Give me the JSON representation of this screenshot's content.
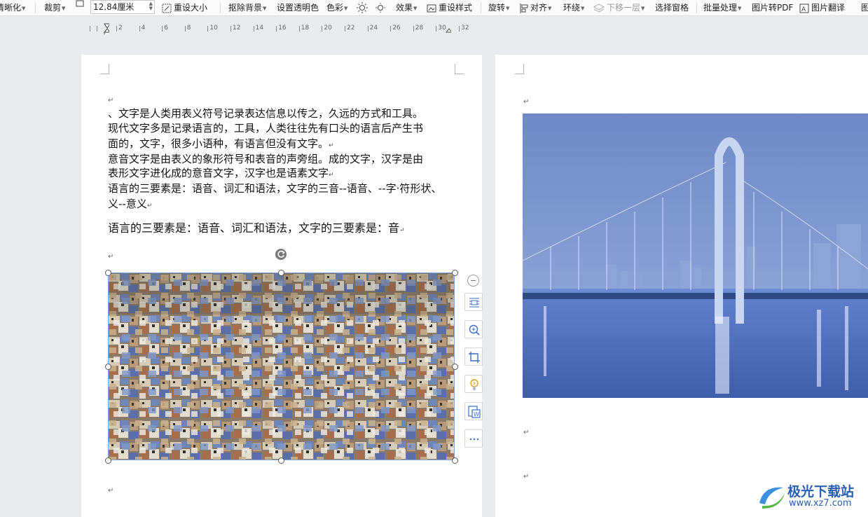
{
  "toolbar": {
    "clear": "清晰化",
    "crop": "裁剪",
    "width_value": "12.84厘米",
    "reset_size": "重设大小",
    "remove_bg": "抠除背景",
    "set_transparent": "设置透明色",
    "color": "色彩",
    "effects": "效果",
    "reset_style": "重设样式",
    "rotate": "旋转",
    "align": "对齐",
    "wrap": "环绕",
    "send_backward": "下移一层",
    "selection_pane": "选择窗格",
    "batch": "批量处理",
    "to_pdf": "图片转PDF",
    "translate": "图片翻译",
    "more": "图"
  },
  "ruler": {
    "labels": [
      "2",
      "4",
      "6",
      "8",
      "10",
      "12",
      "14",
      "16",
      "18",
      "20",
      "22",
      "24",
      "26",
      "28",
      "30",
      "32"
    ]
  },
  "page1": {
    "lines": [
      "、文字是人类用表义符号记录表达信息以传之，久远的方式和工具。",
      "现代文字多是记录语言的，工具，人类往往先有口头的语言后产生书",
      "面的，文字，很多小语种，有语言但没有文字。",
      "意音文字是由表义的象形符号和表音的声旁组。成的文字，汉字是由",
      "表形文字进化成的意音文字，汉字也是语素文字",
      "语言的三要素是：语音、词汇和语法，文字的三音--语音、--字·符形状、",
      "义--意义"
    ],
    "serif_line": "语言的三要素是：语音、词汇和语法，文字的三要素是：音",
    "return_mark": "↵"
  },
  "watermark": {
    "title": "极光下载站",
    "url": "www.xz7.com"
  },
  "colors": {
    "selection": "#7fa7e6",
    "brand": "#2a5eb0"
  }
}
